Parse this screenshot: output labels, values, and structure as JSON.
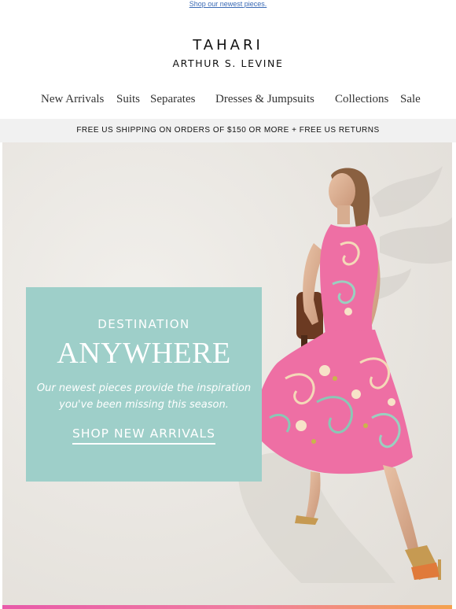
{
  "preheader": {
    "link_text": "Shop our newest pieces."
  },
  "logo": {
    "brand": "TAHARI",
    "sub": "ARTHUR S. LEVINE"
  },
  "nav": {
    "items": [
      {
        "label": "New Arrivals"
      },
      {
        "label": "Suits"
      },
      {
        "label": "Separates"
      },
      {
        "label": "Dresses & Jumpsuits"
      },
      {
        "label": "Collections"
      },
      {
        "label": "Sale"
      }
    ]
  },
  "shipping_banner": {
    "text": "FREE US SHIPPING ON ORDERS OF $150 OR MORE + FREE US RETURNS"
  },
  "hero": {
    "eyebrow": "DESTINATION",
    "headline": "ANYWHERE",
    "copy_line1": "Our newest pieces provide the inspiration",
    "copy_line2": "you've been missing this season.",
    "cta": "SHOP NEW ARRIVALS"
  },
  "colors": {
    "promo_panel": "#9ecfc9",
    "hero_background": "#ebe8e3",
    "dress_pink": "#ee6fa4",
    "shipping_bar": "#f1f1f1"
  }
}
